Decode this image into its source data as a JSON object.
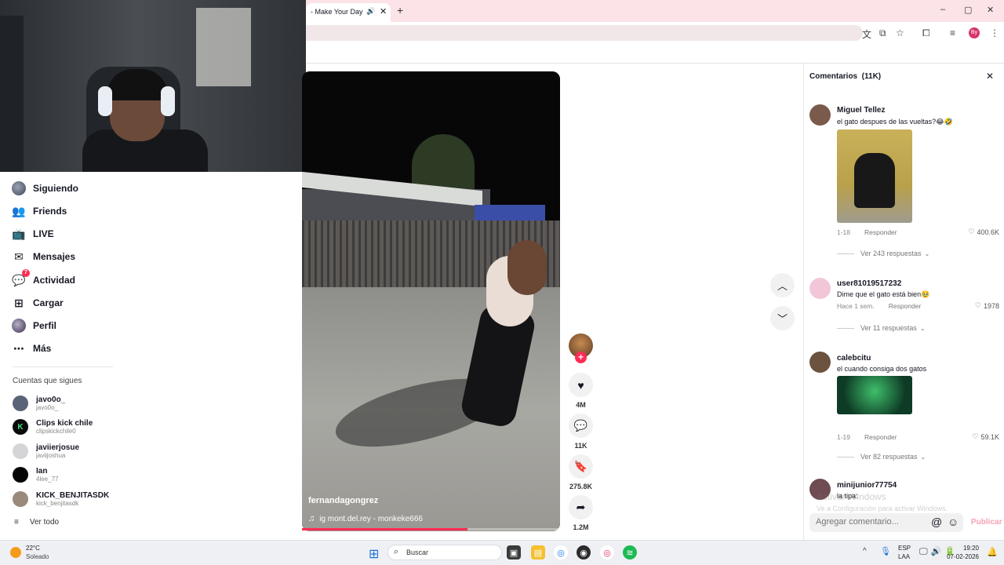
{
  "browser": {
    "tab_title": "- Make Your Day",
    "speaker_icon": "speaker-icon",
    "close_icon": "close-icon",
    "new_tab": "+",
    "window_controls": [
      "–",
      "▢",
      "✕"
    ],
    "profile_initials": "By"
  },
  "sidebar": {
    "nav": [
      {
        "label": "Siguiendo",
        "icon": "avatar-icon"
      },
      {
        "label": "Friends",
        "icon": "friends-icon"
      },
      {
        "label": "LIVE",
        "icon": "live-icon"
      },
      {
        "label": "Mensajes",
        "icon": "messages-icon"
      },
      {
        "label": "Actividad",
        "icon": "activity-icon",
        "badge": "7"
      },
      {
        "label": "Cargar",
        "icon": "upload-icon"
      },
      {
        "label": "Perfil",
        "icon": "profile-icon"
      },
      {
        "label": "Más",
        "icon": "more-icon"
      }
    ],
    "following_title": "Cuentas que sigues",
    "accounts": [
      {
        "name": "javo0o_",
        "handle": "javo0o_",
        "color": "#5b6378"
      },
      {
        "name": "Clips kick chile",
        "handle": "clipskickchile0",
        "color": "#0b0b0b"
      },
      {
        "name": "javiierjosue",
        "handle": "javiijoshua",
        "color": "#d5d5d8"
      },
      {
        "name": "Ian",
        "handle": "4lee_77",
        "color": "#050505"
      },
      {
        "name": "KICK_BENJITASDK",
        "handle": "kick_benjitasdk",
        "color": "#9a8a7c"
      }
    ],
    "see_all": "Ver todo"
  },
  "video": {
    "author": "fernandagongrez",
    "music": "ig mont.del.rey - monkeke666",
    "progress": 0.64,
    "actions": [
      {
        "icon": "heart-icon",
        "count": "4M"
      },
      {
        "icon": "comment-icon",
        "count": "11K"
      },
      {
        "icon": "bookmark-icon",
        "count": "275.8K"
      },
      {
        "icon": "share-icon",
        "count": "1.2M"
      }
    ]
  },
  "comments": {
    "title": "Comentarios  (11K)",
    "items": [
      {
        "user": "Miguel Tellez",
        "text": "el gato despues de las vueltas?😂🤣",
        "time": "1-18",
        "reply": "Responder",
        "likes": "400.6K",
        "replies": "Ver 243 respuestas",
        "avatar_color": "#7a5a4a"
      },
      {
        "user": "user81019517232",
        "text": "Dime que el gato está bien🥹",
        "time": "Hace 1 sem.",
        "reply": "Responder",
        "likes": "1978",
        "replies": "Ver 11 respuestas",
        "avatar_color": "#f2c6d8"
      },
      {
        "user": "calebcitu",
        "text": "el cuando consiga dos gatos",
        "time": "1-19",
        "reply": "Responder",
        "likes": "59.1K",
        "replies": "Ver 82 respuestas",
        "avatar_color": "#6b5340"
      },
      {
        "user": "minijunior77754",
        "text": "la tipa:",
        "avatar_color": "#6e4c52"
      }
    ],
    "input_placeholder": "Agregar comentario...",
    "post_label": "Publicar",
    "watermark_title": "Activar Windows",
    "watermark_sub": "Ve a Configuración para activar Windows."
  },
  "taskbar": {
    "temp": "22°C",
    "weather": "Soleado",
    "search_label": "Buscar",
    "lang1": "ESP",
    "lang2": "LAA",
    "time": "19:20",
    "date": "07-02-2026"
  }
}
